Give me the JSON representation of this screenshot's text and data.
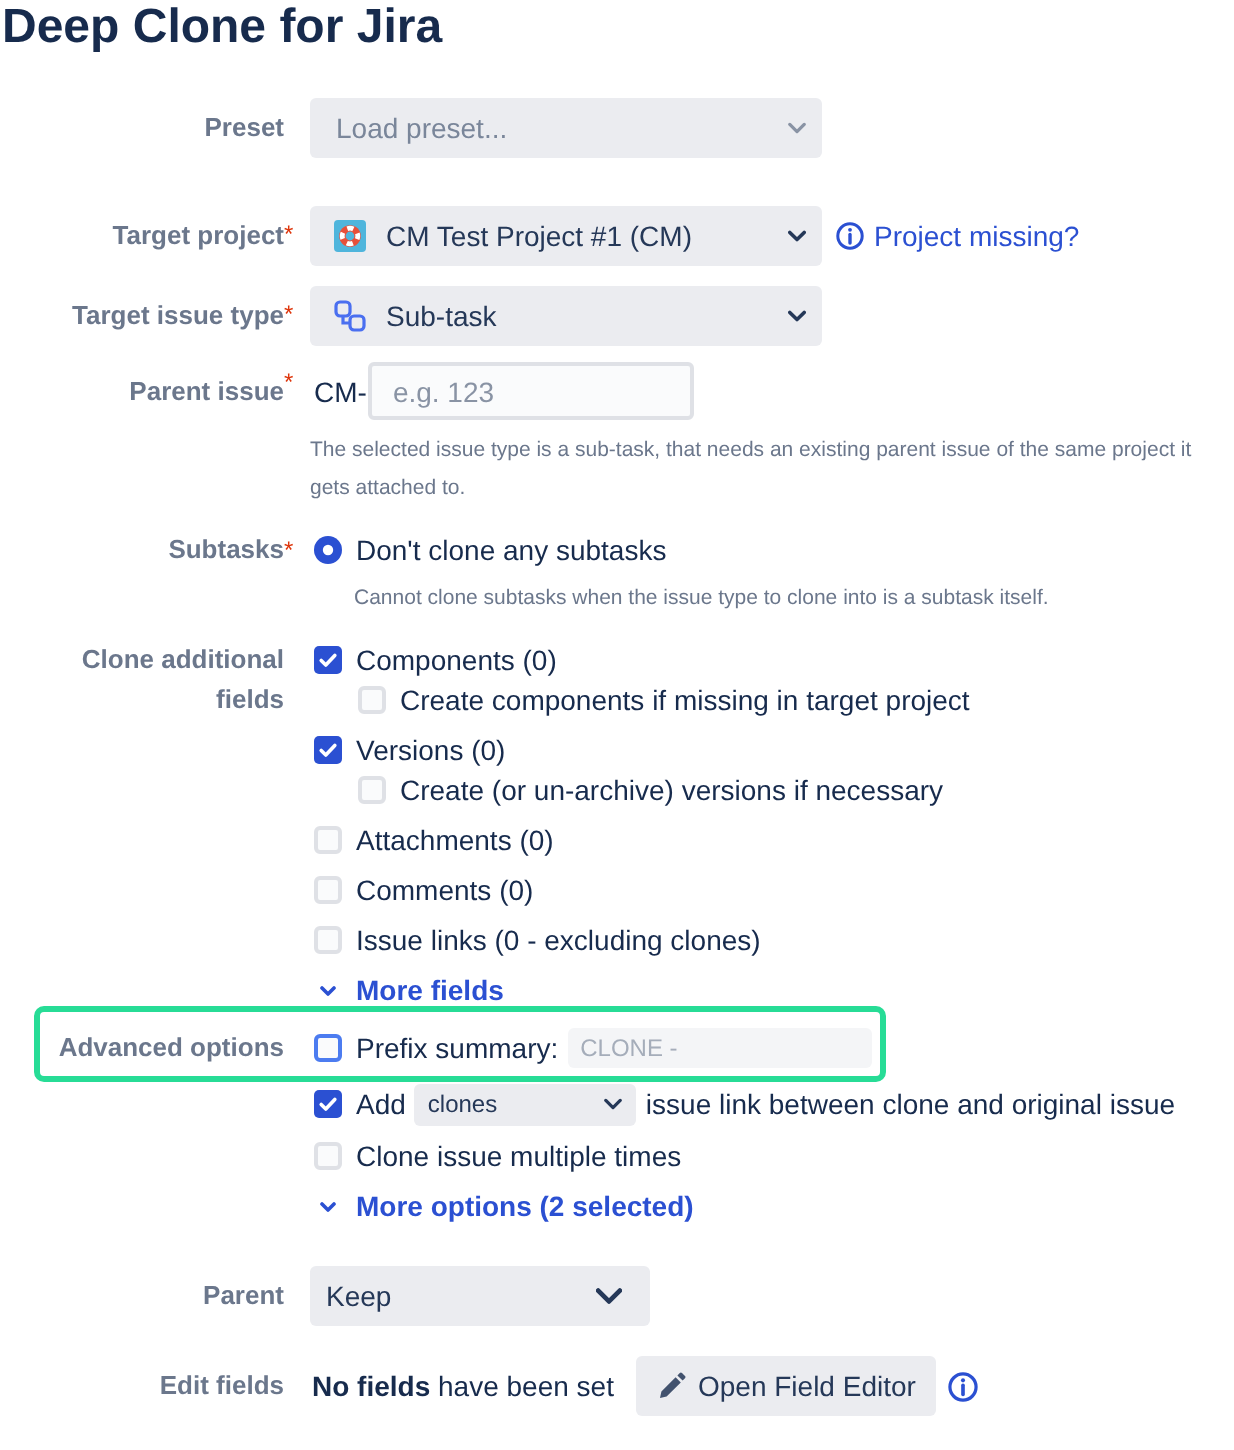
{
  "title": "Deep Clone for Jira",
  "preset": {
    "label": "Preset",
    "placeholder": "Load preset..."
  },
  "target_project": {
    "label": "Target project",
    "required_mark": "*",
    "value": "CM Test Project #1 (CM)",
    "help_link": "Project missing?"
  },
  "target_issue_type": {
    "label": "Target issue type",
    "required_mark": "*",
    "value": "Sub-task"
  },
  "parent_issue": {
    "label": "Parent issue",
    "required_mark": "*",
    "prefix": "CM-",
    "placeholder": "e.g. 123",
    "help": "The selected issue type is a sub-task, that needs an existing parent issue of the same project it gets attached to."
  },
  "subtasks": {
    "label": "Subtasks",
    "required_mark": "*",
    "options": [
      {
        "label": "Don't clone any subtasks",
        "selected": true
      }
    ],
    "help": "Cannot clone subtasks when the issue type to clone into is a subtask itself."
  },
  "clone_additional_fields": {
    "label": "Clone additional fields",
    "items": [
      {
        "label": "Components (0)",
        "checked": true,
        "children": [
          {
            "label": "Create components if missing in target project",
            "checked": false
          }
        ]
      },
      {
        "label": "Versions (0)",
        "checked": true,
        "children": [
          {
            "label": "Create (or un-archive) versions if necessary",
            "checked": false
          }
        ]
      },
      {
        "label": "Attachments (0)",
        "checked": false
      },
      {
        "label": "Comments (0)",
        "checked": false
      },
      {
        "label": "Issue links (0 - excluding clones)",
        "checked": false
      }
    ],
    "more_link": "More fields"
  },
  "advanced_options": {
    "label": "Advanced options",
    "highlighted": true,
    "prefix_summary": {
      "label": "Prefix summary:",
      "checked": false,
      "focused": true,
      "placeholder": "CLONE -"
    },
    "issue_link": {
      "checked": true,
      "before": "Add",
      "value": "clones",
      "after": "issue link between clone and original issue"
    },
    "clone_multiple": {
      "label": "Clone issue multiple times",
      "checked": false
    },
    "more_link": "More options (2 selected)"
  },
  "parent": {
    "label": "Parent",
    "value": "Keep"
  },
  "edit_fields": {
    "label": "Edit fields",
    "status": "**No fields** have been set",
    "button": "Open Field Editor"
  }
}
